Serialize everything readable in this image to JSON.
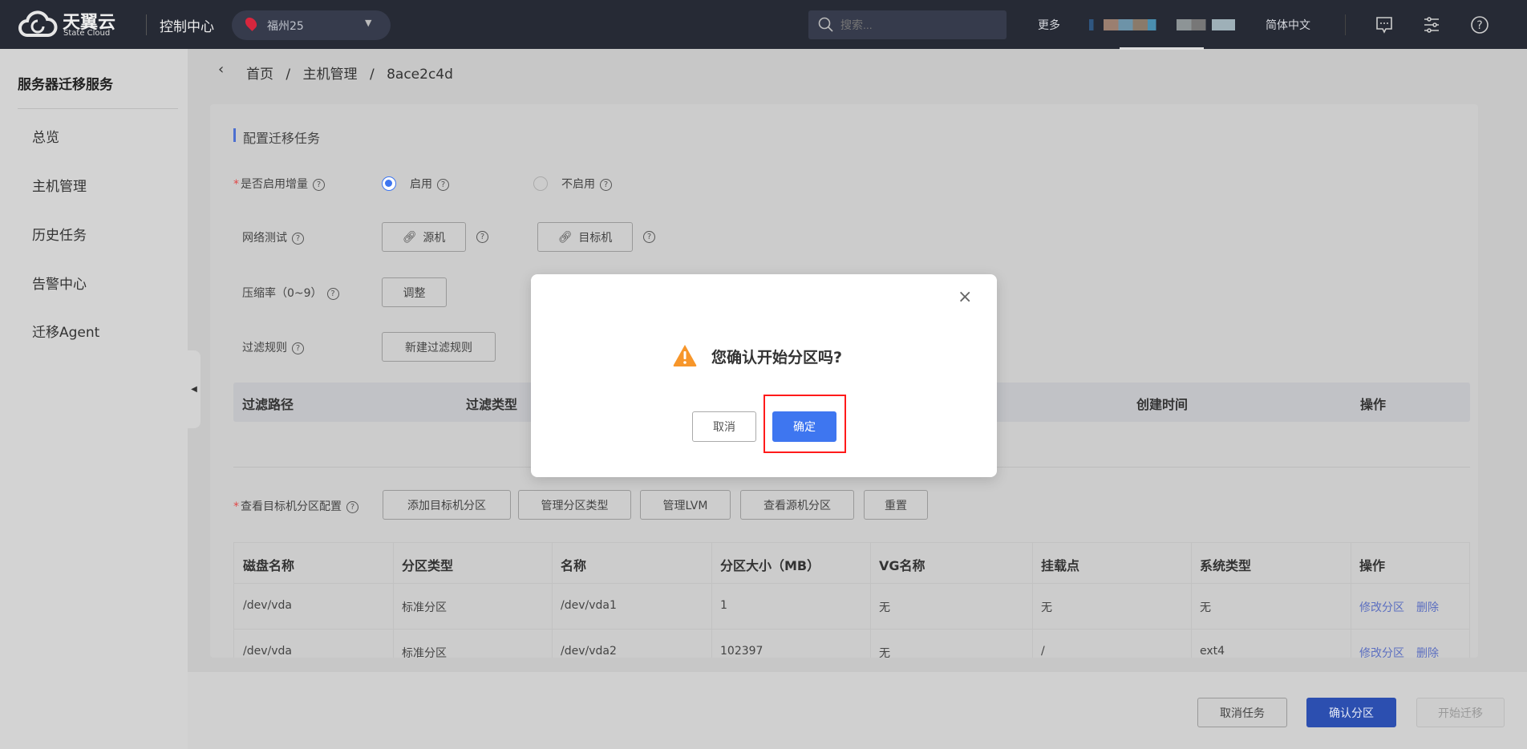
{
  "topbar": {
    "brand_cn": "天翼云",
    "brand_en": "State Cloud",
    "console": "控制中心",
    "region": "福州25",
    "search_placeholder": "搜索...",
    "more": "更多",
    "language": "简体中文",
    "icons": [
      "message-icon",
      "settings-sliders-icon",
      "help-icon"
    ]
  },
  "sidebar": {
    "title": "服务器迁移服务",
    "items": [
      "总览",
      "主机管理",
      "历史任务",
      "告警中心",
      "迁移Agent"
    ]
  },
  "breadcrumb": [
    "首页",
    "主机管理",
    "8ace2c4d"
  ],
  "form": {
    "section_title": "配置迁移任务",
    "incremental": {
      "label": "是否启用增量",
      "options": [
        "启用",
        "不启用"
      ],
      "selected": "启用"
    },
    "network": {
      "label": "网络测试",
      "source": "源机",
      "target": "目标机"
    },
    "compression": {
      "label": "压缩率（0~9）",
      "button": "调整"
    },
    "filter": {
      "label": "过滤规则",
      "button": "新建过滤规则",
      "columns": [
        "过滤路径",
        "过滤类型",
        "创建时间",
        "操作"
      ]
    },
    "partition": {
      "label": "查看目标机分区配置",
      "buttons": [
        "添加目标机分区",
        "管理分区类型",
        "管理LVM",
        "查看源机分区",
        "重置"
      ]
    }
  },
  "partition_table": {
    "columns": [
      "磁盘名称",
      "分区类型",
      "名称",
      "分区大小（MB）",
      "VG名称",
      "挂载点",
      "系统类型",
      "操作"
    ],
    "rows": [
      [
        "/dev/vda",
        "标准分区",
        "/dev/vda1",
        "1",
        "无",
        "无",
        "无"
      ],
      [
        "/dev/vda",
        "标准分区",
        "/dev/vda2",
        "102397",
        "无",
        "/",
        "ext4"
      ]
    ],
    "actions": [
      "修改分区",
      "删除"
    ]
  },
  "footer": {
    "cancel_task": "取消任务",
    "confirm_partition": "确认分区",
    "start_migration": "开始迁移"
  },
  "modal": {
    "message": "您确认开始分区吗?",
    "cancel": "取消",
    "confirm": "确定"
  },
  "colors": {
    "accent": "#3e76f0",
    "topbar": "#262a35",
    "highlight_box": "#ff1a1a",
    "warning": "#f7962a"
  }
}
